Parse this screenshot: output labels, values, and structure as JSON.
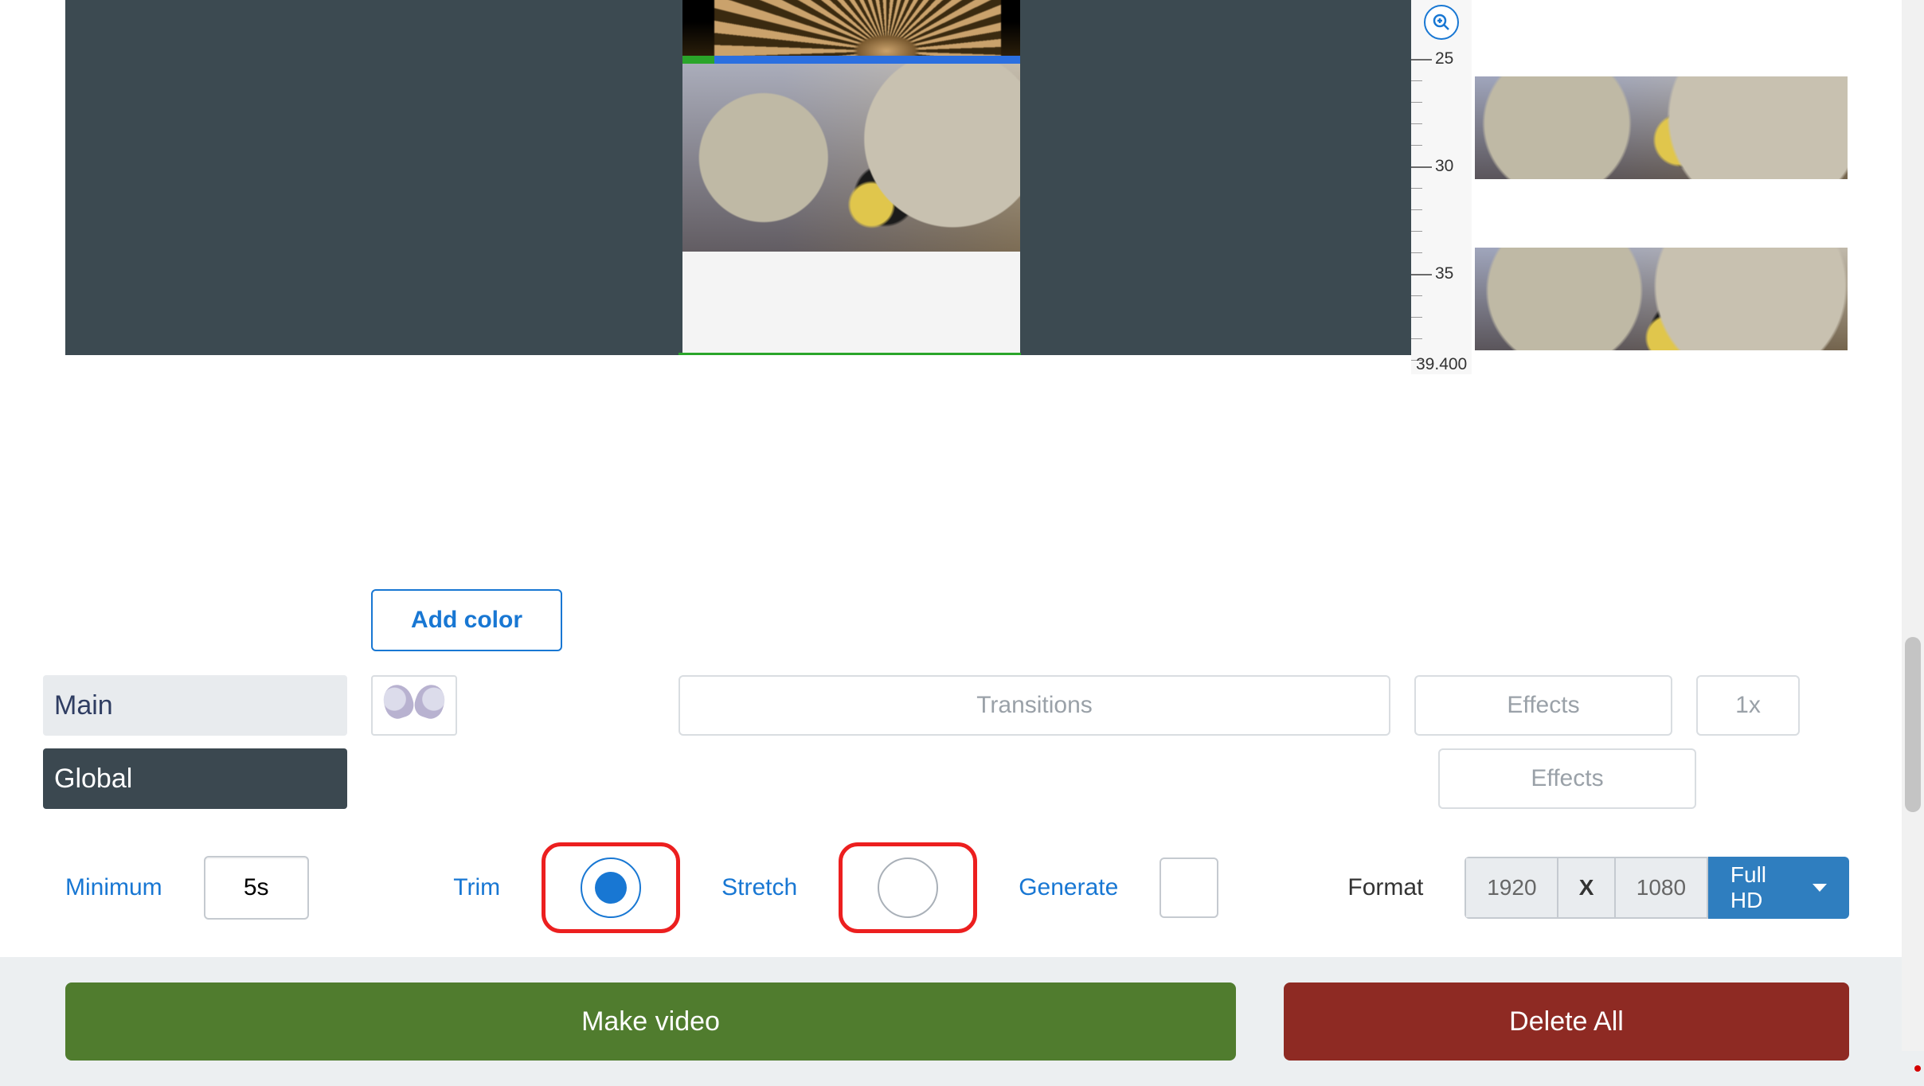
{
  "ruler": {
    "ticks": [
      "25",
      "30",
      "35",
      "39.400"
    ]
  },
  "addColor": "Add color",
  "tracks": {
    "mainLabel": "Main",
    "globalLabel": "Global"
  },
  "placeholders": {
    "transitions": "Transitions",
    "effects": "Effects",
    "speed": "1x"
  },
  "controls": {
    "minimumLabel": "Minimum",
    "minimumValue": "5s",
    "trimLabel": "Trim",
    "stretchLabel": "Stretch",
    "generateLabel": "Generate",
    "formatLabel": "Format",
    "width": "1920",
    "x": "X",
    "height": "1080",
    "preset": "Full HD"
  },
  "actions": {
    "make": "Make video",
    "deleteAll": "Delete All"
  }
}
